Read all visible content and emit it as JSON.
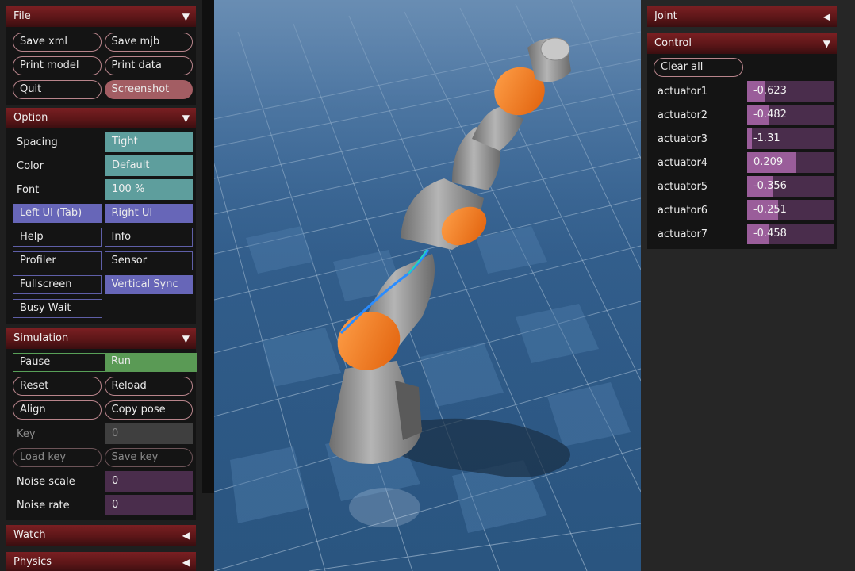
{
  "file": {
    "title": "File",
    "buttons": [
      "Save xml",
      "Save mjb",
      "Print model",
      "Print data",
      "Quit",
      "Screenshot"
    ]
  },
  "option": {
    "title": "Option",
    "spacing_label": "Spacing",
    "spacing_value": "Tight",
    "color_label": "Color",
    "color_value": "Default",
    "font_label": "Font",
    "font_value": "100 %",
    "toggles": [
      "Left UI (Tab)",
      "Right UI",
      "Help",
      "Info",
      "Profiler",
      "Sensor",
      "Fullscreen",
      "Vertical Sync",
      "Busy Wait"
    ]
  },
  "simulation": {
    "title": "Simulation",
    "pause": "Pause",
    "run": "Run",
    "reset": "Reset",
    "reload": "Reload",
    "align": "Align",
    "copy_pose": "Copy pose",
    "key_label": "Key",
    "key_value": "0",
    "load_key": "Load key",
    "save_key": "Save key",
    "noise_scale_label": "Noise scale",
    "noise_scale_value": "0",
    "noise_rate_label": "Noise rate",
    "noise_rate_value": "0"
  },
  "watch": {
    "title": "Watch"
  },
  "physics": {
    "title": "Physics"
  },
  "joint": {
    "title": "Joint"
  },
  "control": {
    "title": "Control",
    "clear_all": "Clear all",
    "actuators": [
      {
        "name": "actuator1",
        "value": "-0.623",
        "fraction": 0.2
      },
      {
        "name": "actuator2",
        "value": "-0.482",
        "fraction": 0.25
      },
      {
        "name": "actuator3",
        "value": "-1.31",
        "fraction": 0.05
      },
      {
        "name": "actuator4",
        "value": "0.209",
        "fraction": 0.55
      },
      {
        "name": "actuator5",
        "value": "-0.356",
        "fraction": 0.3
      },
      {
        "name": "actuator6",
        "value": "-0.251",
        "fraction": 0.35
      },
      {
        "name": "actuator7",
        "value": "-0.458",
        "fraction": 0.25
      }
    ]
  },
  "icons": {
    "expanded": "triangle-down-icon",
    "collapsed": "triangle-left-icon"
  },
  "colors": {
    "header": "#6b1a1d",
    "teal": "#5e9e9d",
    "toggle_on": "#6766b8",
    "run_green": "#5a9a55",
    "slider_fill": "#9a5d9a"
  }
}
